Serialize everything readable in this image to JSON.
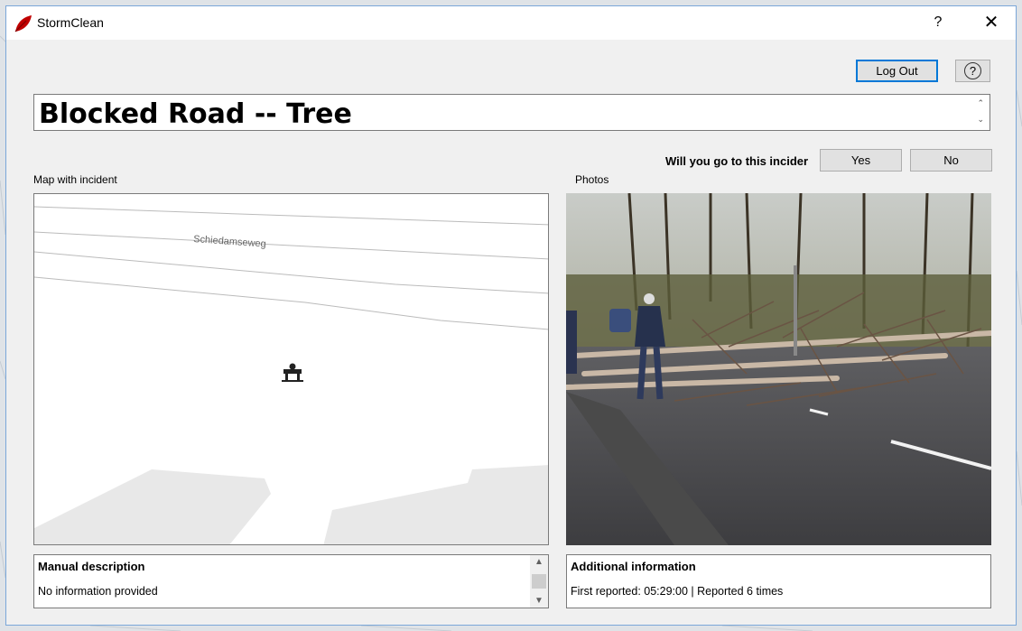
{
  "app": {
    "title": "StormClean"
  },
  "titlebar": {
    "help_glyph": "?",
    "close_glyph": "✕"
  },
  "header": {
    "logout_label": "Log Out",
    "help_glyph": "?"
  },
  "incident": {
    "title": "Blocked Road -- Tree",
    "question": "Will you go to this incider",
    "yes_label": "Yes",
    "no_label": "No"
  },
  "map": {
    "label": "Map with incident",
    "street_name": "Schiedamseweg",
    "marker_icon": "roadblock-icon"
  },
  "photos": {
    "label": "Photos"
  },
  "description": {
    "header": "Manual description",
    "text": "No information provided"
  },
  "info": {
    "header": "Additional information",
    "text": "First reported: 05:29:00 | Reported 6 times"
  },
  "colors": {
    "accent": "#0078d7",
    "brand": "#c00000",
    "window_bg": "#f0f0f0"
  }
}
